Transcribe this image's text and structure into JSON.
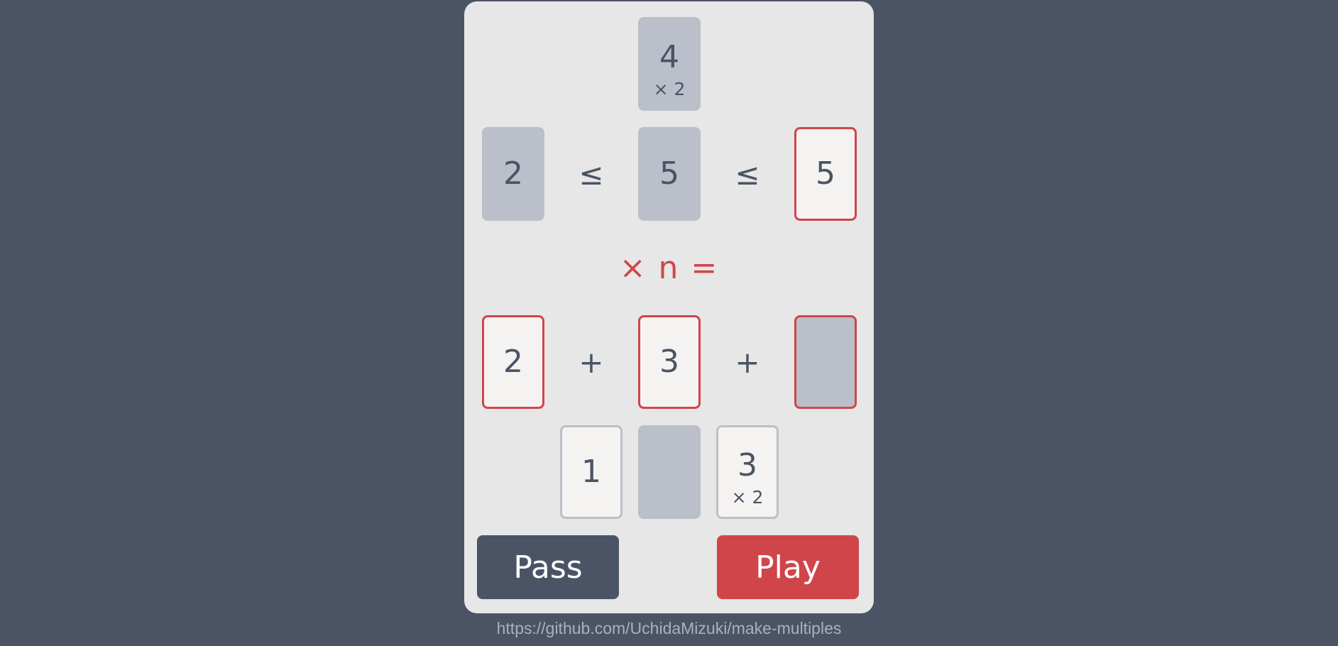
{
  "top_card": {
    "value": "4",
    "multiplier": "× 2"
  },
  "inequality_row": {
    "left": "2",
    "op1": "≤",
    "middle": "5",
    "op2": "≤",
    "right": "5"
  },
  "formula": "× n =",
  "sum_row": {
    "card1": "2",
    "op1": "+",
    "card2": "3",
    "op2": "+",
    "card3": ""
  },
  "hand": [
    {
      "value": "1",
      "multiplier": ""
    },
    {
      "value": "",
      "multiplier": ""
    },
    {
      "value": "3",
      "multiplier": "× 2"
    }
  ],
  "buttons": {
    "pass": "Pass",
    "play": "Play"
  },
  "footer_link": "https://github.com/UchidaMizuki/make-multiples",
  "colors": {
    "background": "#4a5464",
    "panel": "#e7e7e7",
    "accent": "#d0454a",
    "card_gray": "#bbbfc9"
  }
}
